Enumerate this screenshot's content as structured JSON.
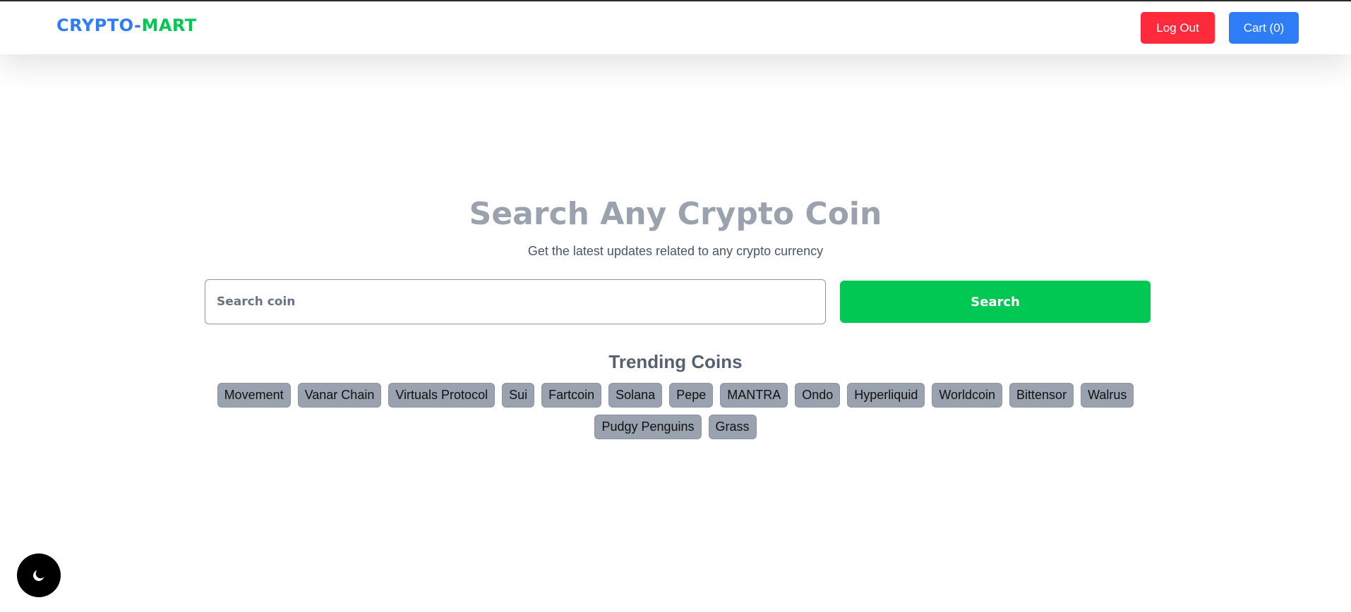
{
  "navbar": {
    "logo_part1": "CRYPTO-",
    "logo_part2": "MART",
    "logout_label": "Log Out",
    "cart_label": "Cart (0)"
  },
  "hero": {
    "title": "Search Any Crypto Coin",
    "subtitle": "Get the latest updates related to any crypto currency"
  },
  "search": {
    "placeholder": "Search coin",
    "value": "",
    "button_label": "Search"
  },
  "trending": {
    "title": "Trending Coins",
    "coins": [
      "Movement",
      "Vanar Chain",
      "Virtuals Protocol",
      "Sui",
      "Fartcoin",
      "Solana",
      "Pepe",
      "MANTRA",
      "Ondo",
      "Hyperliquid",
      "Worldcoin",
      "Bittensor",
      "Walrus",
      "Pudgy Penguins",
      "Grass"
    ]
  },
  "theme_toggle": {
    "icon": "moon-icon"
  },
  "colors": {
    "brand_blue": "#2e7cf6",
    "brand_green": "#00c853",
    "logout_red": "#ff2b3d",
    "chip_gray": "#9aa2b0"
  }
}
